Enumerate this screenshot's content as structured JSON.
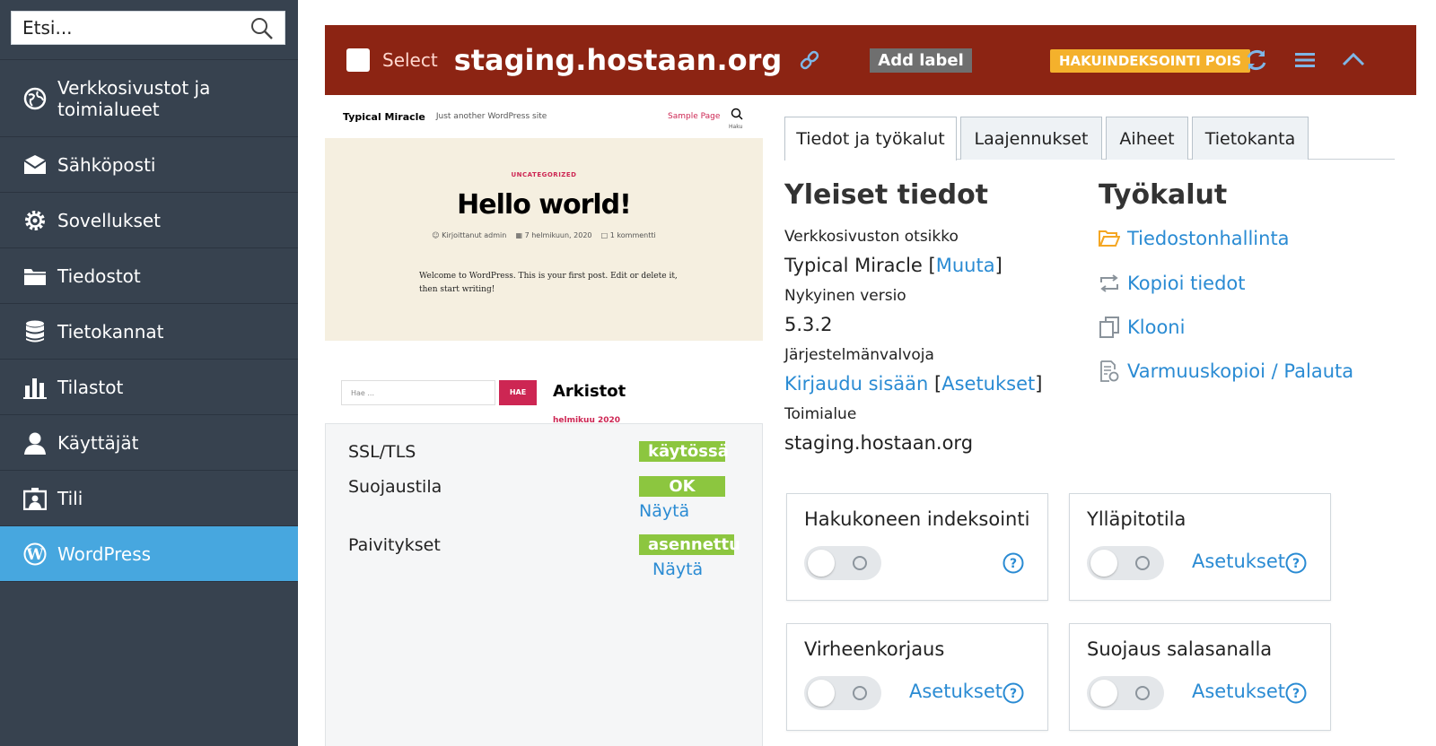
{
  "sidebar": {
    "search_placeholder": "Etsi...",
    "items": [
      {
        "label": "Verkkosivustot ja toimialueet",
        "icon": "globe-icon"
      },
      {
        "label": "Sähköposti",
        "icon": "mail-icon"
      },
      {
        "label": "Sovellukset",
        "icon": "gear-icon"
      },
      {
        "label": "Tiedostot",
        "icon": "folder-icon"
      },
      {
        "label": "Tietokannat",
        "icon": "database-icon"
      },
      {
        "label": "Tilastot",
        "icon": "chart-icon"
      },
      {
        "label": "Käyttäjät",
        "icon": "user-icon"
      },
      {
        "label": "Tili",
        "icon": "account-icon"
      },
      {
        "label": "WordPress",
        "icon": "wordpress-icon",
        "active": true
      }
    ]
  },
  "header": {
    "select_label": "Select",
    "domain_title": "staging.hostaan.org",
    "add_label": "Add label",
    "indexing_badge": "HAKUINDEKSOINTI POIS",
    "color": "#8c2413"
  },
  "preview": {
    "site_title": "Typical Miracle",
    "tagline": "Just another WordPress site",
    "sample_page": "Sample Page",
    "search_sub": "Haku",
    "category": "UNCATEGORIZED",
    "post_title": "Hello world!",
    "meta_author": "Kirjoittanut admin",
    "meta_date": "7 helmikuun, 2020",
    "meta_comments": "1 kommentti",
    "body_text": "Welcome to WordPress. This is your first post. Edit or delete it, then start writing!",
    "search_placeholder": "Hae ...",
    "search_button": "HAE",
    "archives_title": "Arkistot",
    "archive_month": "helmikuu 2020"
  },
  "status": {
    "ssl_label": "SSL/TLS",
    "ssl_value": "käytössä",
    "security_label": "Suojaustila",
    "security_value": "OK",
    "security_link": "Näytä",
    "updates_label": "Paivitykset",
    "updates_value": "asennettu",
    "updates_link": "Näytä",
    "badge_color": "#8cc63f"
  },
  "tabs": [
    {
      "label": "Tiedot ja työkalut",
      "active": true
    },
    {
      "label": "Laajennukset"
    },
    {
      "label": "Aiheet"
    },
    {
      "label": "Tietokanta"
    }
  ],
  "general": {
    "title": "Yleiset tiedot",
    "site_title_label": "Verkkosivuston otsikko",
    "site_title_value": "Typical Miracle",
    "change_link": "Muuta",
    "version_label": "Nykyinen versio",
    "version_value": "5.3.2",
    "admin_label": "Järjestelmänvalvoja",
    "login_link": "Kirjaudu sisään",
    "settings_link": "Asetukset",
    "domain_label": "Toimialue",
    "domain_link": "staging.hostaan.org"
  },
  "tools": {
    "title": "Työkalut",
    "items": [
      {
        "label": "Tiedostonhallinta",
        "icon": "folder-open-icon"
      },
      {
        "label": "Kopioi tiedot",
        "icon": "sync-copy-icon"
      },
      {
        "label": "Klooni",
        "icon": "clone-icon"
      },
      {
        "label": "Varmuuskopioi / Palauta",
        "icon": "backup-icon"
      }
    ]
  },
  "cards": {
    "search_indexing": {
      "title": "Hakukoneen indeksointi",
      "enabled": false
    },
    "maintenance": {
      "title": "Ylläpitotila",
      "settings": "Asetukset",
      "enabled": false
    },
    "debugging": {
      "title": "Virheenkorjaus",
      "settings": "Asetukset",
      "enabled": false
    },
    "password_protection": {
      "title": "Suojaus salasanalla",
      "settings": "Asetukset",
      "enabled": false
    }
  },
  "colors": {
    "link": "#2a8bd3",
    "sidebar_bg": "#37424f",
    "sidebar_active": "#47a7df",
    "badge_orange": "#f4b12c"
  }
}
